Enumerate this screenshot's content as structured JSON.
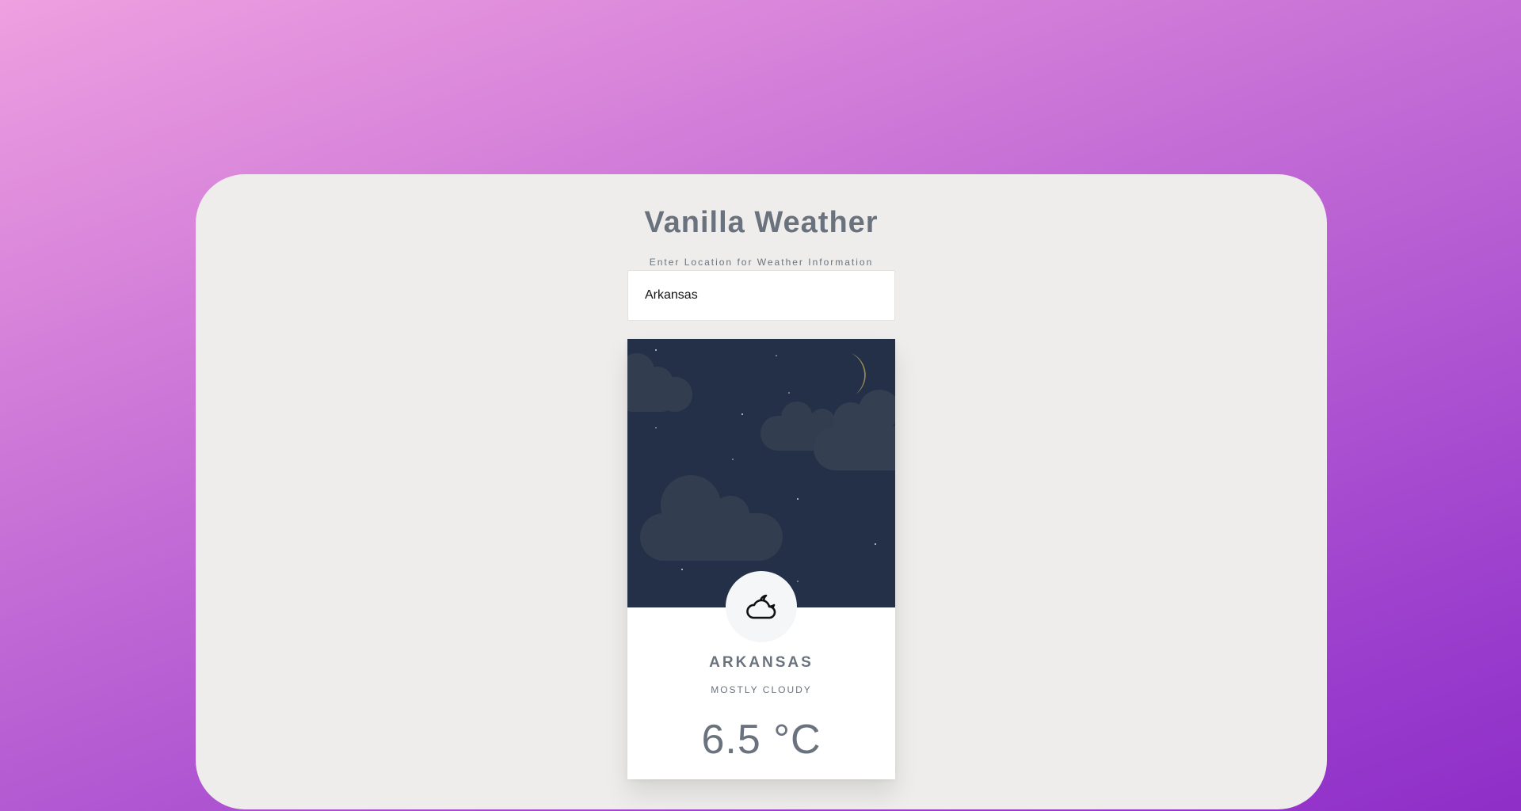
{
  "app": {
    "title": "Vanilla Weather"
  },
  "search": {
    "label": "Enter Location for Weather Information",
    "value": "Arkansas"
  },
  "weather": {
    "location": "ARKANSAS",
    "condition": "MOSTLY CLOUDY",
    "temperature": "6.5 °C",
    "icon": "cloud-moon-icon",
    "scene": "night-sky",
    "scene_icons": [
      "moon-icon",
      "cloud-icon",
      "star-icon"
    ]
  },
  "colors": {
    "background_gradient": [
      "#eea0e0",
      "#c66fd6",
      "#8f2ec8"
    ],
    "panel": "#eeedeb",
    "sky": "#243047",
    "cloud": "#323e50",
    "moon": "#f7de7c",
    "text_muted": "#6a737d"
  }
}
